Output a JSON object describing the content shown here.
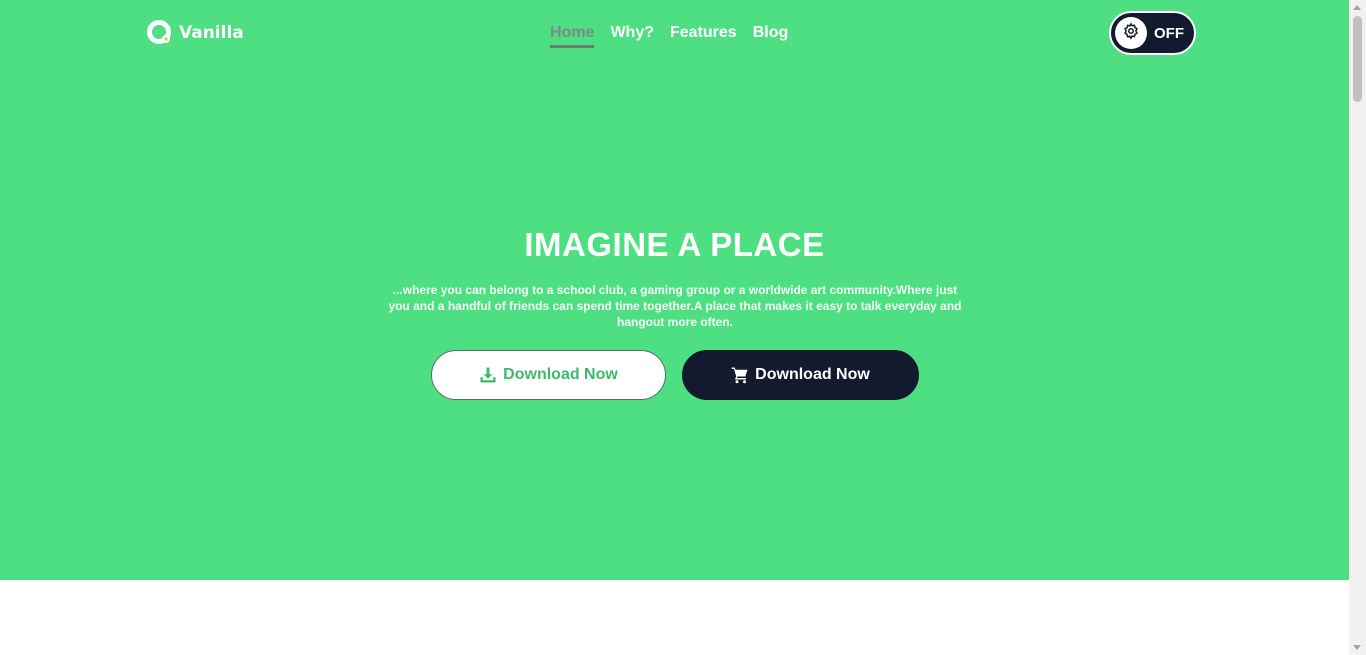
{
  "brand": {
    "name": "Vanilla"
  },
  "nav": {
    "items": [
      {
        "label": "Home",
        "active": true
      },
      {
        "label": "Why?",
        "active": false
      },
      {
        "label": "Features",
        "active": false
      },
      {
        "label": "Blog",
        "active": false
      }
    ]
  },
  "toggle": {
    "label": "OFF",
    "icon": "gear-icon"
  },
  "hero": {
    "title": "IMAGINE A PLACE",
    "text": "...where you can belong to a school club, a gaming group or a worldwide art community.Where just you and a handful of friends can spend time together.A place that makes it easy to talk everyday and hangout more often.",
    "buttons": [
      {
        "label": "Download Now",
        "icon": "download-icon",
        "style": "light"
      },
      {
        "label": "Download Now",
        "icon": "cart-icon",
        "style": "dark"
      }
    ]
  },
  "colors": {
    "hero_bg": "#4ddf82",
    "dark": "#131a2e",
    "accent_green": "#3cb96b",
    "nav_active": "#7a8b86"
  }
}
